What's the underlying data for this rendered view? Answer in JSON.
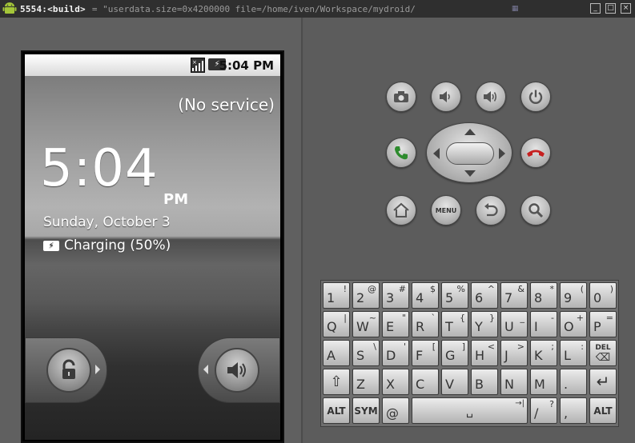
{
  "window": {
    "title": "5554:<build>",
    "command_ghost": "= \"userdata.size=0x4200000 file=/home/iven/Workspace/mydroid/",
    "controls": [
      "_",
      "□",
      "×"
    ]
  },
  "phone": {
    "status_time": "5:04 PM",
    "no_service": "(No service)",
    "clock_time": "5:04",
    "clock_ampm": "PM",
    "date": "Sunday, October 3",
    "charging": "Charging (50%)",
    "unlock_icon": "unlock-icon",
    "sound_icon": "sound-on-icon"
  },
  "hardware_buttons": {
    "camera": "camera-icon",
    "volume_down": "volume-down-icon",
    "volume_up": "volume-up-icon",
    "power": "power-icon",
    "call": "call-icon",
    "end_call": "end-call-icon",
    "home": "home-icon",
    "menu_label": "MENU",
    "back": "back-icon",
    "search": "search-icon"
  },
  "keyboard": {
    "row1": [
      {
        "main": "1",
        "alt": "!"
      },
      {
        "main": "2",
        "alt": "@"
      },
      {
        "main": "3",
        "alt": "#"
      },
      {
        "main": "4",
        "alt": "$"
      },
      {
        "main": "5",
        "alt": "%"
      },
      {
        "main": "6",
        "alt": "^"
      },
      {
        "main": "7",
        "alt": "&"
      },
      {
        "main": "8",
        "alt": "*"
      },
      {
        "main": "9",
        "alt": "("
      },
      {
        "main": "0",
        "alt": ")"
      }
    ],
    "row2": [
      {
        "main": "Q",
        "alt": "|"
      },
      {
        "main": "W",
        "alt": "~"
      },
      {
        "main": "E",
        "alt": "\""
      },
      {
        "main": "R",
        "alt": "`"
      },
      {
        "main": "T",
        "alt": "{"
      },
      {
        "main": "Y",
        "alt": "}"
      },
      {
        "main": "U",
        "alt": "_"
      },
      {
        "main": "I",
        "alt": "-"
      },
      {
        "main": "O",
        "alt": "+"
      },
      {
        "main": "P",
        "alt": "="
      }
    ],
    "row3": [
      {
        "main": "A",
        "alt": ""
      },
      {
        "main": "S",
        "alt": "\\"
      },
      {
        "main": "D",
        "alt": "'"
      },
      {
        "main": "F",
        "alt": "["
      },
      {
        "main": "G",
        "alt": "]"
      },
      {
        "main": "H",
        "alt": "<"
      },
      {
        "main": "J",
        "alt": ">"
      },
      {
        "main": "K",
        "alt": ";"
      },
      {
        "main": "L",
        "alt": ":"
      },
      {
        "main": "DEL",
        "alt": ""
      }
    ],
    "row4": [
      {
        "main": "⇧",
        "alt": ""
      },
      {
        "main": "Z",
        "alt": ""
      },
      {
        "main": "X",
        "alt": ""
      },
      {
        "main": "C",
        "alt": ""
      },
      {
        "main": "V",
        "alt": ""
      },
      {
        "main": "B",
        "alt": ""
      },
      {
        "main": "N",
        "alt": ""
      },
      {
        "main": "M",
        "alt": ""
      },
      {
        "main": ".",
        "alt": ""
      },
      {
        "main": "↵",
        "alt": ""
      }
    ],
    "row5": [
      {
        "main": "ALT",
        "alt": ""
      },
      {
        "main": "SYM",
        "alt": ""
      },
      {
        "main": "@",
        "alt": ""
      },
      {
        "main": "␣",
        "alt": "→|"
      },
      {
        "main": "/",
        "alt": "?"
      },
      {
        "main": ",",
        "alt": ""
      },
      {
        "main": "ALT",
        "alt": ""
      }
    ]
  }
}
